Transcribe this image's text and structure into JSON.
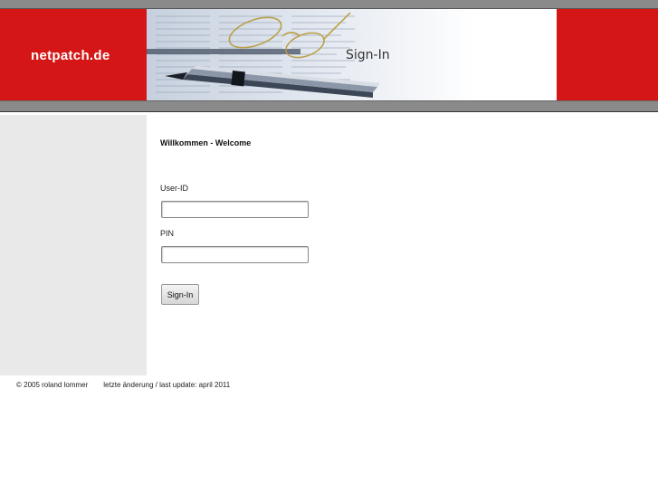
{
  "header": {
    "logo": "netpatch.de",
    "title": "Sign-In",
    "banner_image": "financial newspaper with pen and glasses"
  },
  "form": {
    "welcome": "Willkommen - Welcome",
    "userid_label": "User-ID",
    "userid_value": "",
    "pin_label": "PIN",
    "pin_value": "",
    "submit_label": "Sign-In"
  },
  "footer": {
    "copyright": "© 2005 roland lommer",
    "last_update": "letzte änderung / last update: april 2011"
  },
  "colors": {
    "brand_red": "#d41616",
    "bar_gray": "#8a8a8a",
    "sidebar_gray": "#e9e9e9"
  }
}
